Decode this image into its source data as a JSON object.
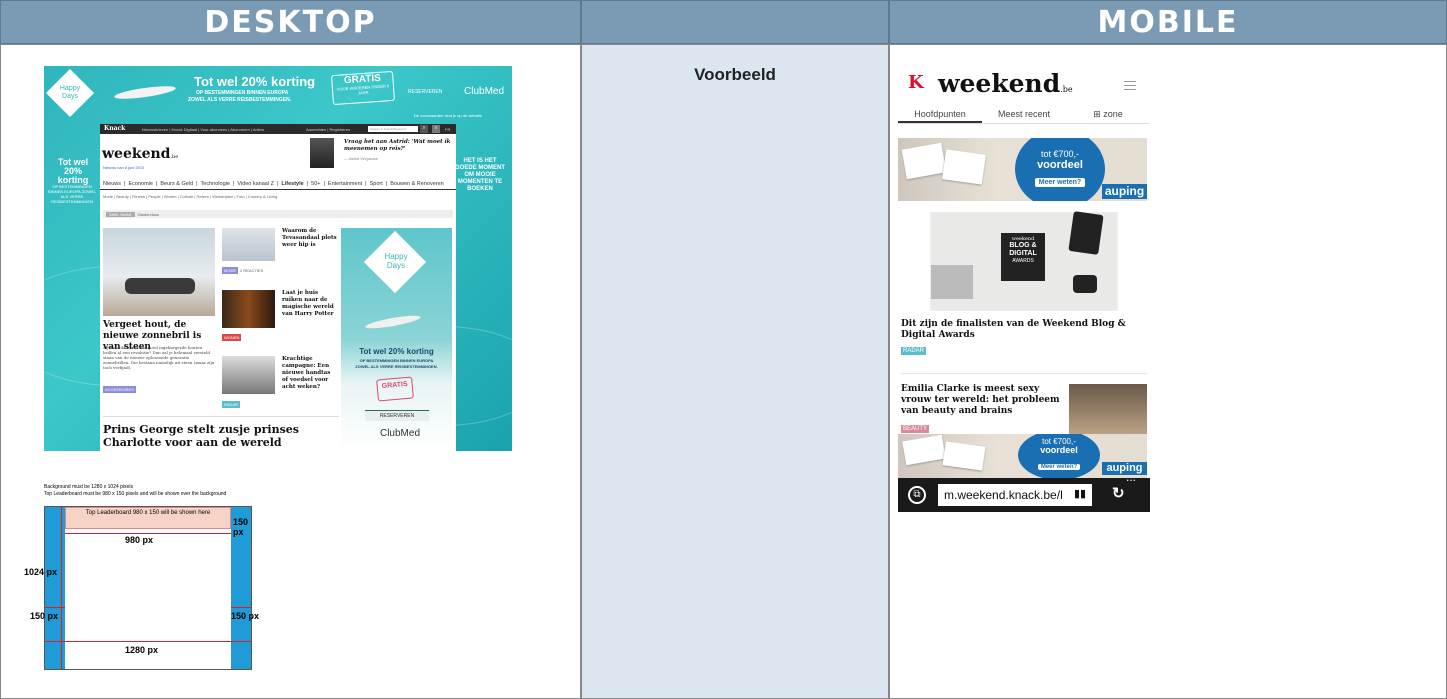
{
  "headers": {
    "desktop": "DESKTOP",
    "middle": "",
    "mobile": "MOBILE"
  },
  "middle_label": "Voorbeeld",
  "desktop": {
    "leaderboard": {
      "happy": "Happy\nDays",
      "title": "Tot wel 20% korting",
      "sub1": "OP BESTEMMINGEN BINNEN EUROPA",
      "sub2": "ZOWEL ALS VERRE REISBESTEMMINGEN.",
      "gratis": "GRATIS",
      "gratis_sub": "VOOR KINDEREN ONDER 6 JAAR",
      "reserveren": "RESERVEREN",
      "brand": "ClubMed",
      "small": "De voorwaarden vind je op de website"
    },
    "left_side": "Tot wel 20% korting",
    "left_side_sub": "OP BESTEMMINGEN BINNEN EUROPA ZOWEL ALS VERRE REISBESTEMMINGEN",
    "right_side": "HET IS HET GOEDE MOMENT OM MOOIE MOMENTEN TE BOEKEN",
    "topbar": {
      "logo": "Knack",
      "links": "Nieuwsbrieven | Knack Digitaal | Voor abonnees | Abonneren | Adlers",
      "login": "Aanmelden | Registreren",
      "search_placeholder": "Zoeken in Knack/Weekend",
      "lang": "FR"
    },
    "weekend_logo": "weekend",
    "weekend_be": ".be",
    "date": "Nieuws van 6 juni 2015",
    "astrid": "Vraag het aan Astrid: 'Wat moet ik meenemen op reis?'",
    "astrid_by": "— Astrid Vergauwe",
    "nav": [
      "Nieuws",
      "Economie",
      "Beurs & Geld",
      "Technologie",
      "Video kanaal Z",
      "Lifestyle",
      "50+",
      "Entertainment",
      "Sport",
      "Bouwen & Renoveren"
    ],
    "subnav": "Mode | Beauty | Fitness | People | Wonen | Culinair | Reizen | Wedstrijden | Foto | Country & Living",
    "crumb_tag": "SNEL NAAR",
    "crumb_text": "Masterclass",
    "main_title": "Vergeet hout, de nieuwe zonnebril is van steen",
    "main_text": "Zij vond de inmiddels goed ingeburgerde houten brillen al een revolutie? Dan zal je helemaal versteld staan van de nieuwe oplossende generatie zonnebrillen. Die bestaan namelijk uit steen (maar zijn toch verfijnd).",
    "main_badge": "ACCESSOIRES",
    "side_articles": [
      {
        "title": "Waarom de Tevasandaal plots weer hip is",
        "badge": "MODE",
        "extra": "2 REACTIES"
      },
      {
        "title": "Laat je huis ruiken naar de magische wereld van Harry Potter",
        "badge": "WONEN",
        "extra": ""
      },
      {
        "title": "Krachtige campagne: Een nieuwe handtas of voedsel voor acht weken?",
        "badge": "RADAR",
        "extra": ""
      }
    ],
    "bottom_title": "Prins George stelt zusje prinses Charlotte voor aan de wereld",
    "side_ad": {
      "happy": "Happy\nDays",
      "title": "Tot wel 20% korting",
      "sub1": "OP BESTEMMINGEN BINNEN EUROPA",
      "sub2": "ZOWEL ALS VERRE REISBESTEMMINGEN.",
      "gratis": "GRATIS",
      "reserveren": "RESERVEREN",
      "brand": "ClubMed"
    }
  },
  "diagram": {
    "note1": "Background must be 1280 x 1024 pixels",
    "note2": "Top Leaderboard must be 980 x 150 pixels and will be shown over the background",
    "lb_label": "Top Leaderboard 980 x 150 will be shown here",
    "w980": "980 px",
    "h150_right": "150 px",
    "h1024": "1024 px",
    "w150_left": "150 px",
    "w150_right": "150 px",
    "w1280": "1280 px"
  },
  "mobile": {
    "k": "K",
    "logo": "weekend",
    "be": ".be",
    "tabs": [
      "Hoofdpunten",
      "Meest recent",
      "zone"
    ],
    "ad_price_top": "tot €700,-",
    "ad_price_bottom": "voordeel",
    "ad_button": "Meer weten?",
    "ad_brand": "auping",
    "blog_top": "weekend",
    "blog_main": "BLOG & DIGITAL",
    "blog_sub": "AWARDS",
    "article1": "Dit zijn de finalisten van de Weekend Blog & Digital Awards",
    "badge1": "RADAR",
    "article2": "Emilia Clarke is meest sexy vrouw ter wereld: het probleem van beauty and brains",
    "badge2": "BEAUTY",
    "url": "m.weekend.knack.be/l",
    "more": "..."
  },
  "colors": {
    "header": "#7b9bb4",
    "middle": "#dce6f0",
    "sea": "#2fb6bd",
    "diagram_blue": "#1f9bd7",
    "auping_blue": "#1a6fb3"
  }
}
